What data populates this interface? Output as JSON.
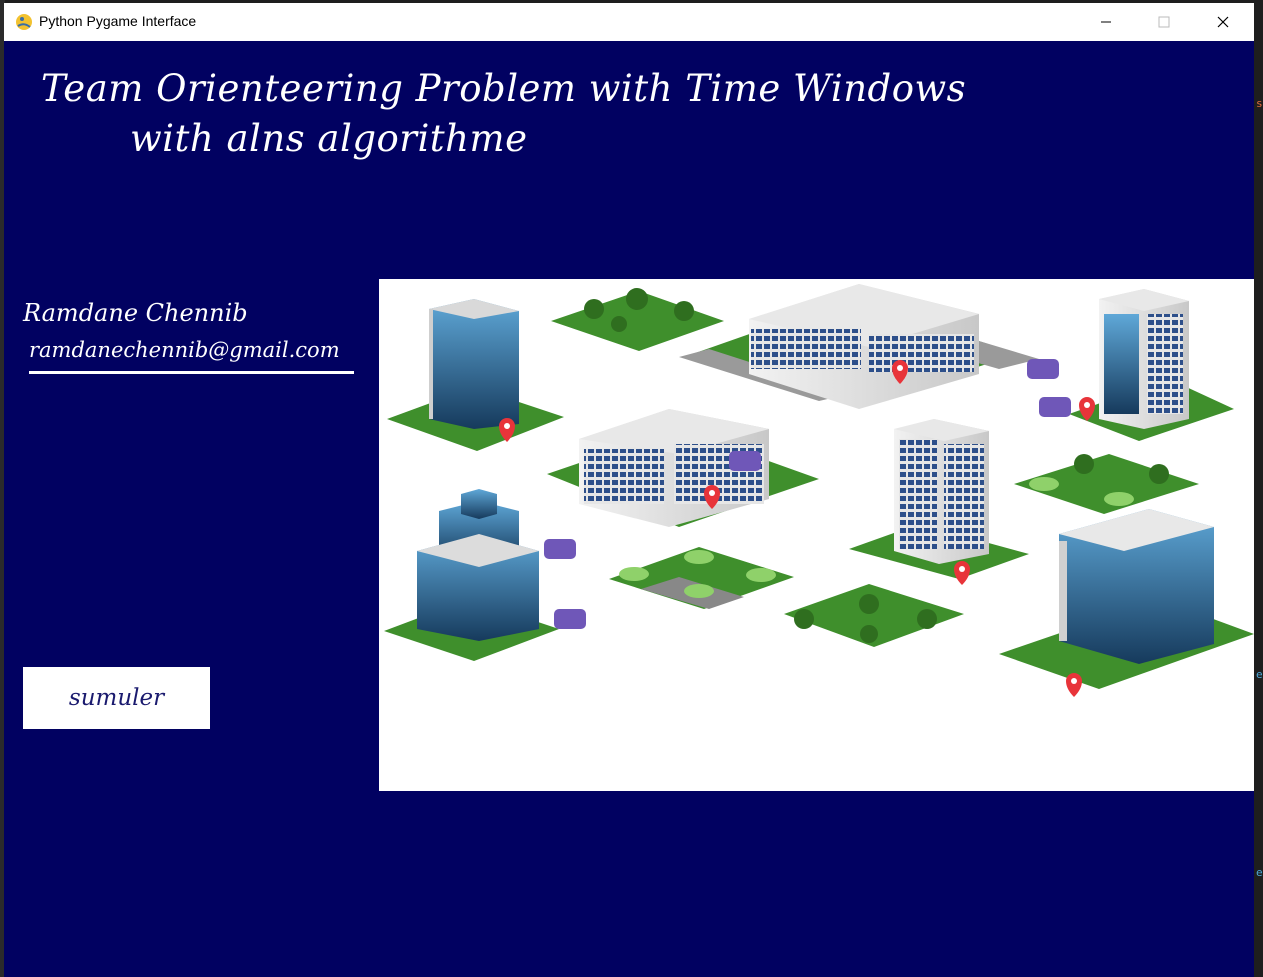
{
  "window": {
    "title": "Python Pygame Interface",
    "controls": [
      "minimize",
      "maximize",
      "close"
    ],
    "background_color": "#010161"
  },
  "header": {
    "line1": "Team Orienteering Problem with Time Windows",
    "line2": "with alns algorithme"
  },
  "author": {
    "name": "Ramdane Chennib",
    "email": "ramdanechennib@gmail.com"
  },
  "actions": {
    "simulate_label": "sumuler"
  },
  "illustration": {
    "subject": "isometric city map with buildings, parks, vans and location pins"
  }
}
